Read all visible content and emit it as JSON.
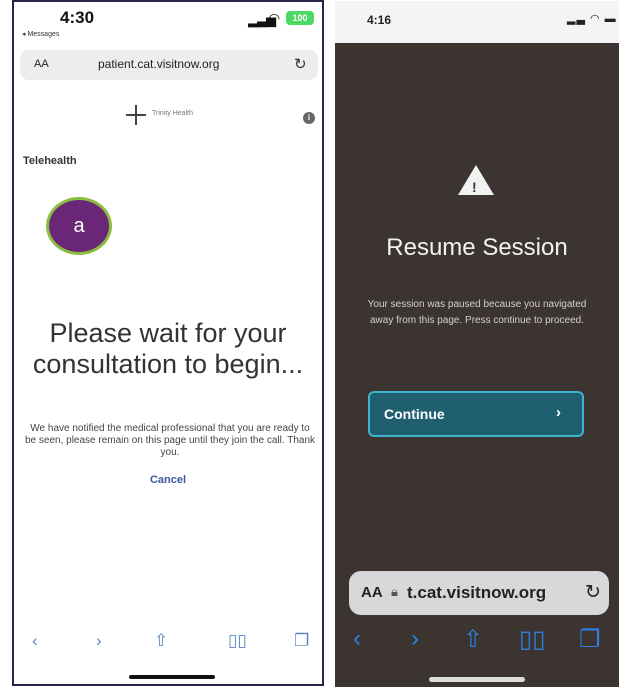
{
  "left_screen": {
    "status": {
      "time": "4:30",
      "back_app": "◂ Messages",
      "battery": "100"
    },
    "address_bar": {
      "aa": "AA",
      "url": "patient.cat.visitnow.org"
    },
    "logo_text": "Trinity Health",
    "section_label": "Telehealth",
    "heading": "Please wait for your consultation to begin...",
    "message": "We have notified the medical professional that you are ready to be seen, please remain on this page until they join the call. Thank you.",
    "cancel_label": "Cancel",
    "marker_label": "a"
  },
  "right_screen": {
    "status": {
      "time": "4:16"
    },
    "title": "Resume Session",
    "message": "Your session was paused because you navigated away from this page. Press continue to proceed.",
    "continue_label": "Continue",
    "address_bar": {
      "aa": "AA",
      "url": "t.cat.visitnow.org"
    }
  },
  "icons": {
    "back": "chevron-left-icon",
    "forward": "chevron-right-icon",
    "share": "share-icon",
    "bookmarks": "book-icon",
    "tabs": "tabs-icon",
    "reload": "reload-icon",
    "warning": "warning-icon",
    "lock": "lock-icon"
  },
  "colors": {
    "marker_fill": "#6a2778",
    "marker_border": "#8bbd3e",
    "continue_fill": "#1f5f70",
    "continue_border": "#3fb4cf",
    "toolbar_icon_light": "#5a86c9",
    "toolbar_icon_dark": "#2f7fe6",
    "dark_background": "#3b3430"
  }
}
